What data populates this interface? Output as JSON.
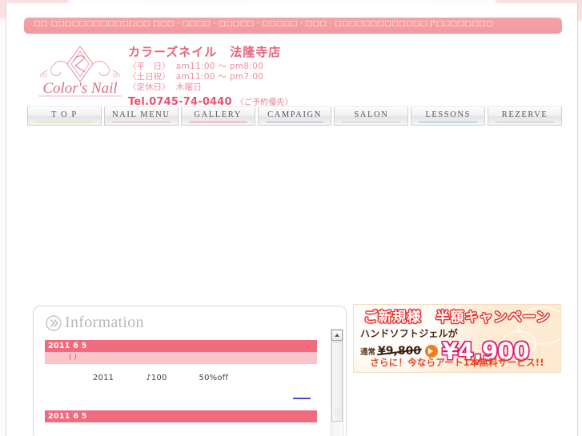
{
  "topbar": {
    "text": "□□ □□□□□□□□□□□□□□ □□□ · □□□□ · □□□□□ · □□□□□ · □□□ · □□□□□□□□□□□□□ |ᴿ□□□□□□□□"
  },
  "header": {
    "logo_text": "Color's Nail",
    "shop_name": "カラーズネイル　法隆寺店",
    "hours": [
      {
        "label": "〈平　日〉",
        "value": "am11:00 ～ pm8:00"
      },
      {
        "label": "〈土日祝〉",
        "value": "am11:00 ～ pm7:00"
      },
      {
        "label": "〈定休日〉",
        "value": "木曜日"
      }
    ],
    "tel": "Tel.0745-74-0440",
    "tel_note": "〈ご予約優先〉"
  },
  "nav": {
    "items": [
      {
        "label": "T O P",
        "underline": "#e8e07a"
      },
      {
        "label": "NAIL MENU",
        "underline": "#e8a9a0"
      },
      {
        "label": "GALLERY",
        "underline": "#f07d8e"
      },
      {
        "label": "CAMPAIGN",
        "underline": "#b79ad0"
      },
      {
        "label": "SALON",
        "underline": "#c9c9c9"
      },
      {
        "label": "LESSONS",
        "underline": "#7fc4e0"
      },
      {
        "label": "REZERVE",
        "underline": "#d9b9c4"
      }
    ]
  },
  "information": {
    "title": "Information",
    "icon": "double-chevron-circle-icon",
    "entries": [
      {
        "date": "2011 6 5",
        "subtitle": "( )",
        "body": [
          "2011",
          "♪100",
          "50%off"
        ]
      },
      {
        "date": "2011 6 5"
      }
    ]
  },
  "scrollbar": {
    "up_arrow": "scroll-up-icon"
  },
  "banner": {
    "line1": "ご新規様　半額キャンペーン",
    "line2": "ハンドソフトジェルが",
    "usual_label": "通常",
    "old_price": "¥9,800",
    "arrow": "arrow-right-icon",
    "new_price": "¥4,900",
    "line4": "さらに！今ならアート1本無料サービス!!"
  },
  "colors": {
    "pink_bar": "#f2999d",
    "accent_pink": "#f26a7e",
    "light_pink": "#fbc4cb",
    "brand_red": "#e8536f",
    "link_blue": "#4b4bd6",
    "banner_orange": "#e8451e"
  }
}
